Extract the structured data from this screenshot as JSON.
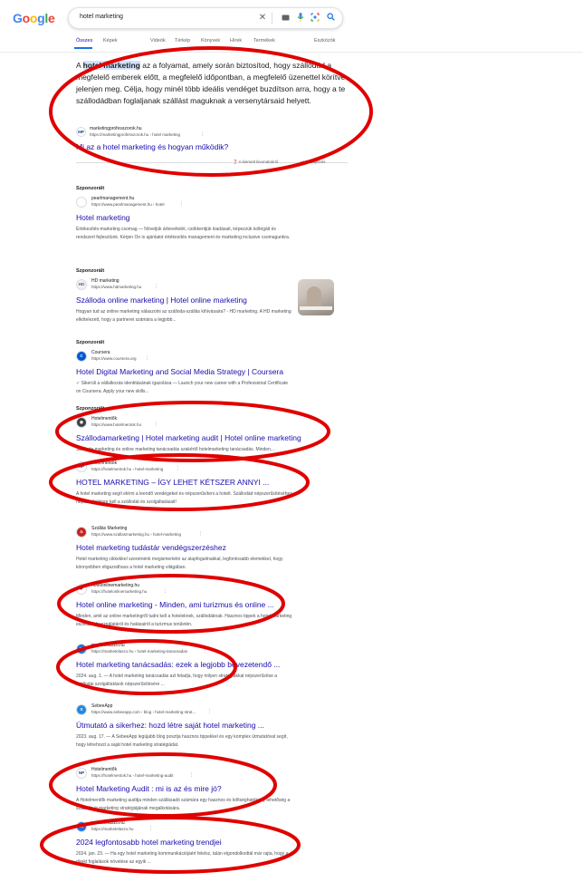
{
  "logo": {
    "letters": [
      "G",
      "o",
      "o",
      "g",
      "l",
      "e"
    ],
    "colors": [
      "#4285f4",
      "#ea4335",
      "#fbbc05",
      "#4285f4",
      "#34a853",
      "#ea4335"
    ]
  },
  "search": {
    "query": "hotel marketing",
    "clear_icon": "close-icon",
    "keyboard_icon": "keyboard-icon",
    "mic_icon": "mic-icon",
    "lens_icon": "lens-icon",
    "search_icon": "search-icon"
  },
  "tabs": [
    {
      "label": "Összes"
    },
    {
      "label": "Képek"
    },
    {
      "label": "Videók"
    },
    {
      "label": "Térkép"
    },
    {
      "label": "Könyvek"
    },
    {
      "label": "Hírek"
    },
    {
      "label": "Termékek"
    }
  ],
  "tools": "Eszközök",
  "featured": {
    "text_before": "A ",
    "text_highlight": "hotel marketing",
    "text_after": " az a folyamat, amely során biztosítod, hogy szállodád a megfelelő emberek előtt, a megfelelő időpontban, a megfelelő üzenettel körítve jelenjen meg. Célja, hogy minél több ideális vendéget buzdítson arra, hogy a te szállodádban foglaljanak szállást maguknak a versenytársaid helyett.",
    "site": "marketingprofesszorok.hu",
    "url": "https://marketingprofesszorok.hu › hotel marketing",
    "title": "Mi az a hotel marketing és hogyan működik?",
    "about": "A kiemelt kivonatokról",
    "feedback": "Visszajelzés"
  },
  "results": [
    {
      "sponsored": "Szponzorált",
      "fav_text": "",
      "fav_color": "#ffffff",
      "fav_fg": "#1a73e8",
      "site": "pearlmanagement.hu",
      "url": "https://www.pearlmanagement.hu › hotel",
      "title": "Hotel marketing",
      "snippet": "Értékesítés-marketing csomag — Növeljük árbevételét, csökkentjük kiadásait, képezzük kollégáit és rendszert fejlesztünk. Kérjen On is ajánlatot értékesítés management és marketing inclusive csomagunkra."
    },
    {
      "sponsored": "Szponzorált",
      "fav_text": "HD",
      "fav_color": "#eef1f6",
      "fav_fg": "#5f6368",
      "site": "HD marketing",
      "url": "https://www.hdmarketing.hu",
      "title": "Szálloda online marketing | Hotel online marketing",
      "snippet": "Hogyan tud az online marketing válaszolni az szálloda-szállás kihívásaira? - HD marketing. A HD marketing elkötelezett, hogy a partnerei számára a legjobb..."
    },
    {
      "sponsored": "Szponzorált",
      "fav_text": "C",
      "fav_color": "#0056d2",
      "fav_fg": "#ffffff",
      "site": "Coursera",
      "url": "https://www.coursera.org",
      "title": "Hotel Digital Marketing and Social Media Strategy | Coursera",
      "snippet": "✓ Sikerüli a vállalkozás identitásának igazolása — Launch your new career with a Professional Certificate on Coursera. Apply your new skills..."
    },
    {
      "sponsored": "Szponzorált",
      "fav_text": "◉",
      "fav_color": "#3c4043",
      "fav_fg": "#ffffff",
      "site": "Hotelmentők",
      "url": "https://www.hotelmentok.hu",
      "title": "Szállodamarketing | Hotel marketing audit | Hotel online marketing",
      "snippet": "Szálloda marketing és online marketing tanácsadás szakértő hotelmarketing tanácsadás. Minden..."
    },
    {
      "sponsored": "",
      "fav_text": "NP",
      "fav_color": "#ffffff",
      "fav_fg": "#1a3d8f",
      "site": "Hotelmentők",
      "url": "https://hotelmentok.hu › hotel-marketing",
      "title": "HOTEL MARKETING – ÍGY LEHET KÉTSZER ANNYI ...",
      "snippet": "A hotel marketing segít elérni a leendő vendégeket és népszerűsíteni a hotelt. Szállodád népszerűsítéséhez népszerűsítésre kell a szállodát és szolgáltatásait!"
    },
    {
      "sponsored": "",
      "fav_text": "♨",
      "fav_color": "#c5221f",
      "fav_fg": "#ffffff",
      "site": "Szállás Marketing",
      "url": "https://www.szallasmarketing.hu › hotel-marketing",
      "title": "Hotel marketing tudástár vendégszerzéshez",
      "snippet": "Hotel marketing cikkekkel szeretnénk megismertetni az alapfogalmakkal, legfontosabb elemekkel, hogy könnyebben eligazodhass a hotel marketing világában."
    },
    {
      "sponsored": "",
      "fav_text": "P",
      "fav_color": "#ffffff",
      "fav_fg": "#202124",
      "site": "hotelonlinemarketing.hu",
      "url": "https://hotelonlinemarketing.hu",
      "title": "Hotel online marketing - Minden, ami turizmus és online ...",
      "snippet": "Minden, amit az online marketingről tudni kell a hoteleknek, szállodáknak. Hasznos tippek a hotel marketing eszközök használatáról és hatásairól a turizmus területén."
    },
    {
      "sponsored": "",
      "fav_text": "M",
      "fav_color": "#1a73e8",
      "fav_fg": "#ffffff",
      "site": "marketelaszo.hu",
      "url": "https://marketelaszo.hu › hotel-marketing-tanacsadas",
      "title": "Hotel marketing tanácsadás: ezek a legjobb bevezetendő ...",
      "snippet": "2024. aug. 1. — A hotel marketing tanácsadás azt feladja, hogy milyen stratégiákkal népszerűsítse a szállodai szolgáltatások népszerűsítésére ..."
    },
    {
      "sponsored": "",
      "fav_text": "S",
      "fav_color": "#1e88e5",
      "fav_fg": "#ffffff",
      "site": "SebeeApp",
      "url": "https://www.sebeeapp.com › blog › hotel-marketing-strat...",
      "title": "Útmutató a sikerhez: hozd létre saját hotel marketing ...",
      "snippet": "2023. aug. 17. — A SebeeApp legújabb blog posztja hasznos tippekkel és egy komplex útmutatóval segít, hogy létrehozd a saját hotel marketing stratégiádat."
    },
    {
      "sponsored": "",
      "fav_text": "NP",
      "fav_color": "#ffffff",
      "fav_fg": "#1a3d8f",
      "site": "Hotelmentők",
      "url": "https://hotelmentok.hu › hotel-marketing-audit",
      "title": "Hotel Marketing Audit : mi is az és mire jó?",
      "snippet": "A Hotelmentők marketing auditja minden szállásadó számára egy hasznos és költséghatékony lehetőség a szálloda új marketing stratégiájának megalkotására."
    },
    {
      "sponsored": "",
      "fav_text": "M",
      "fav_color": "#1a73e8",
      "fav_fg": "#ffffff",
      "site": "marketelaszo.hu",
      "url": "https://marketelaszo.hu",
      "title": "2024 legfontosabb hotel marketing trendjei",
      "snippet": "2024. jan. 23. — Ha egy hotel marketing kommunikációjáért felelsz, talán elgondolkodtál már rajta, hogy a direkt foglalások növelése az egyik ..."
    }
  ],
  "annotation_color": "#e00000"
}
